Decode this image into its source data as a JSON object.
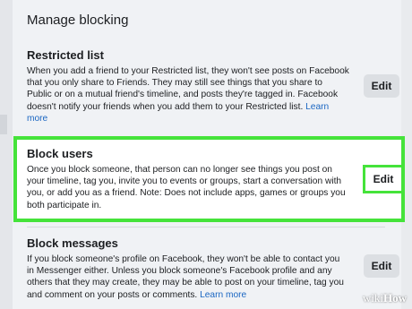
{
  "heading": "Manage blocking",
  "restricted": {
    "title": "Restricted list",
    "body": "When you add a friend to your Restricted list, they won't see posts on Facebook that you only share to Friends. They may still see things that you share to Public or on a mutual friend's timeline, and posts they're tagged in. Facebook doesn't notify your friends when you add them to your Restricted list.",
    "learn_more": "Learn more",
    "edit": "Edit"
  },
  "block_users": {
    "title": "Block users",
    "body": "Once you block someone, that person can no longer see things you post on your timeline, tag you, invite you to events or groups, start a conversation with you, or add you as a friend. Note: Does not include apps, games or groups you both participate in.",
    "edit": "Edit"
  },
  "block_messages": {
    "title": "Block messages",
    "body": "If you block someone's profile on Facebook, they won't be able to contact you in Messenger either. Unless you block someone's Facebook profile and any others that they may create, they may be able to post on your timeline, tag you and comment on your posts or comments.",
    "learn_more": "Learn more",
    "edit": "Edit"
  },
  "watermark": {
    "wiki": "wiki",
    "how": "How"
  },
  "colors": {
    "highlight": "#45e33a",
    "link": "#1a66c2",
    "button": "#dcdfe3"
  }
}
